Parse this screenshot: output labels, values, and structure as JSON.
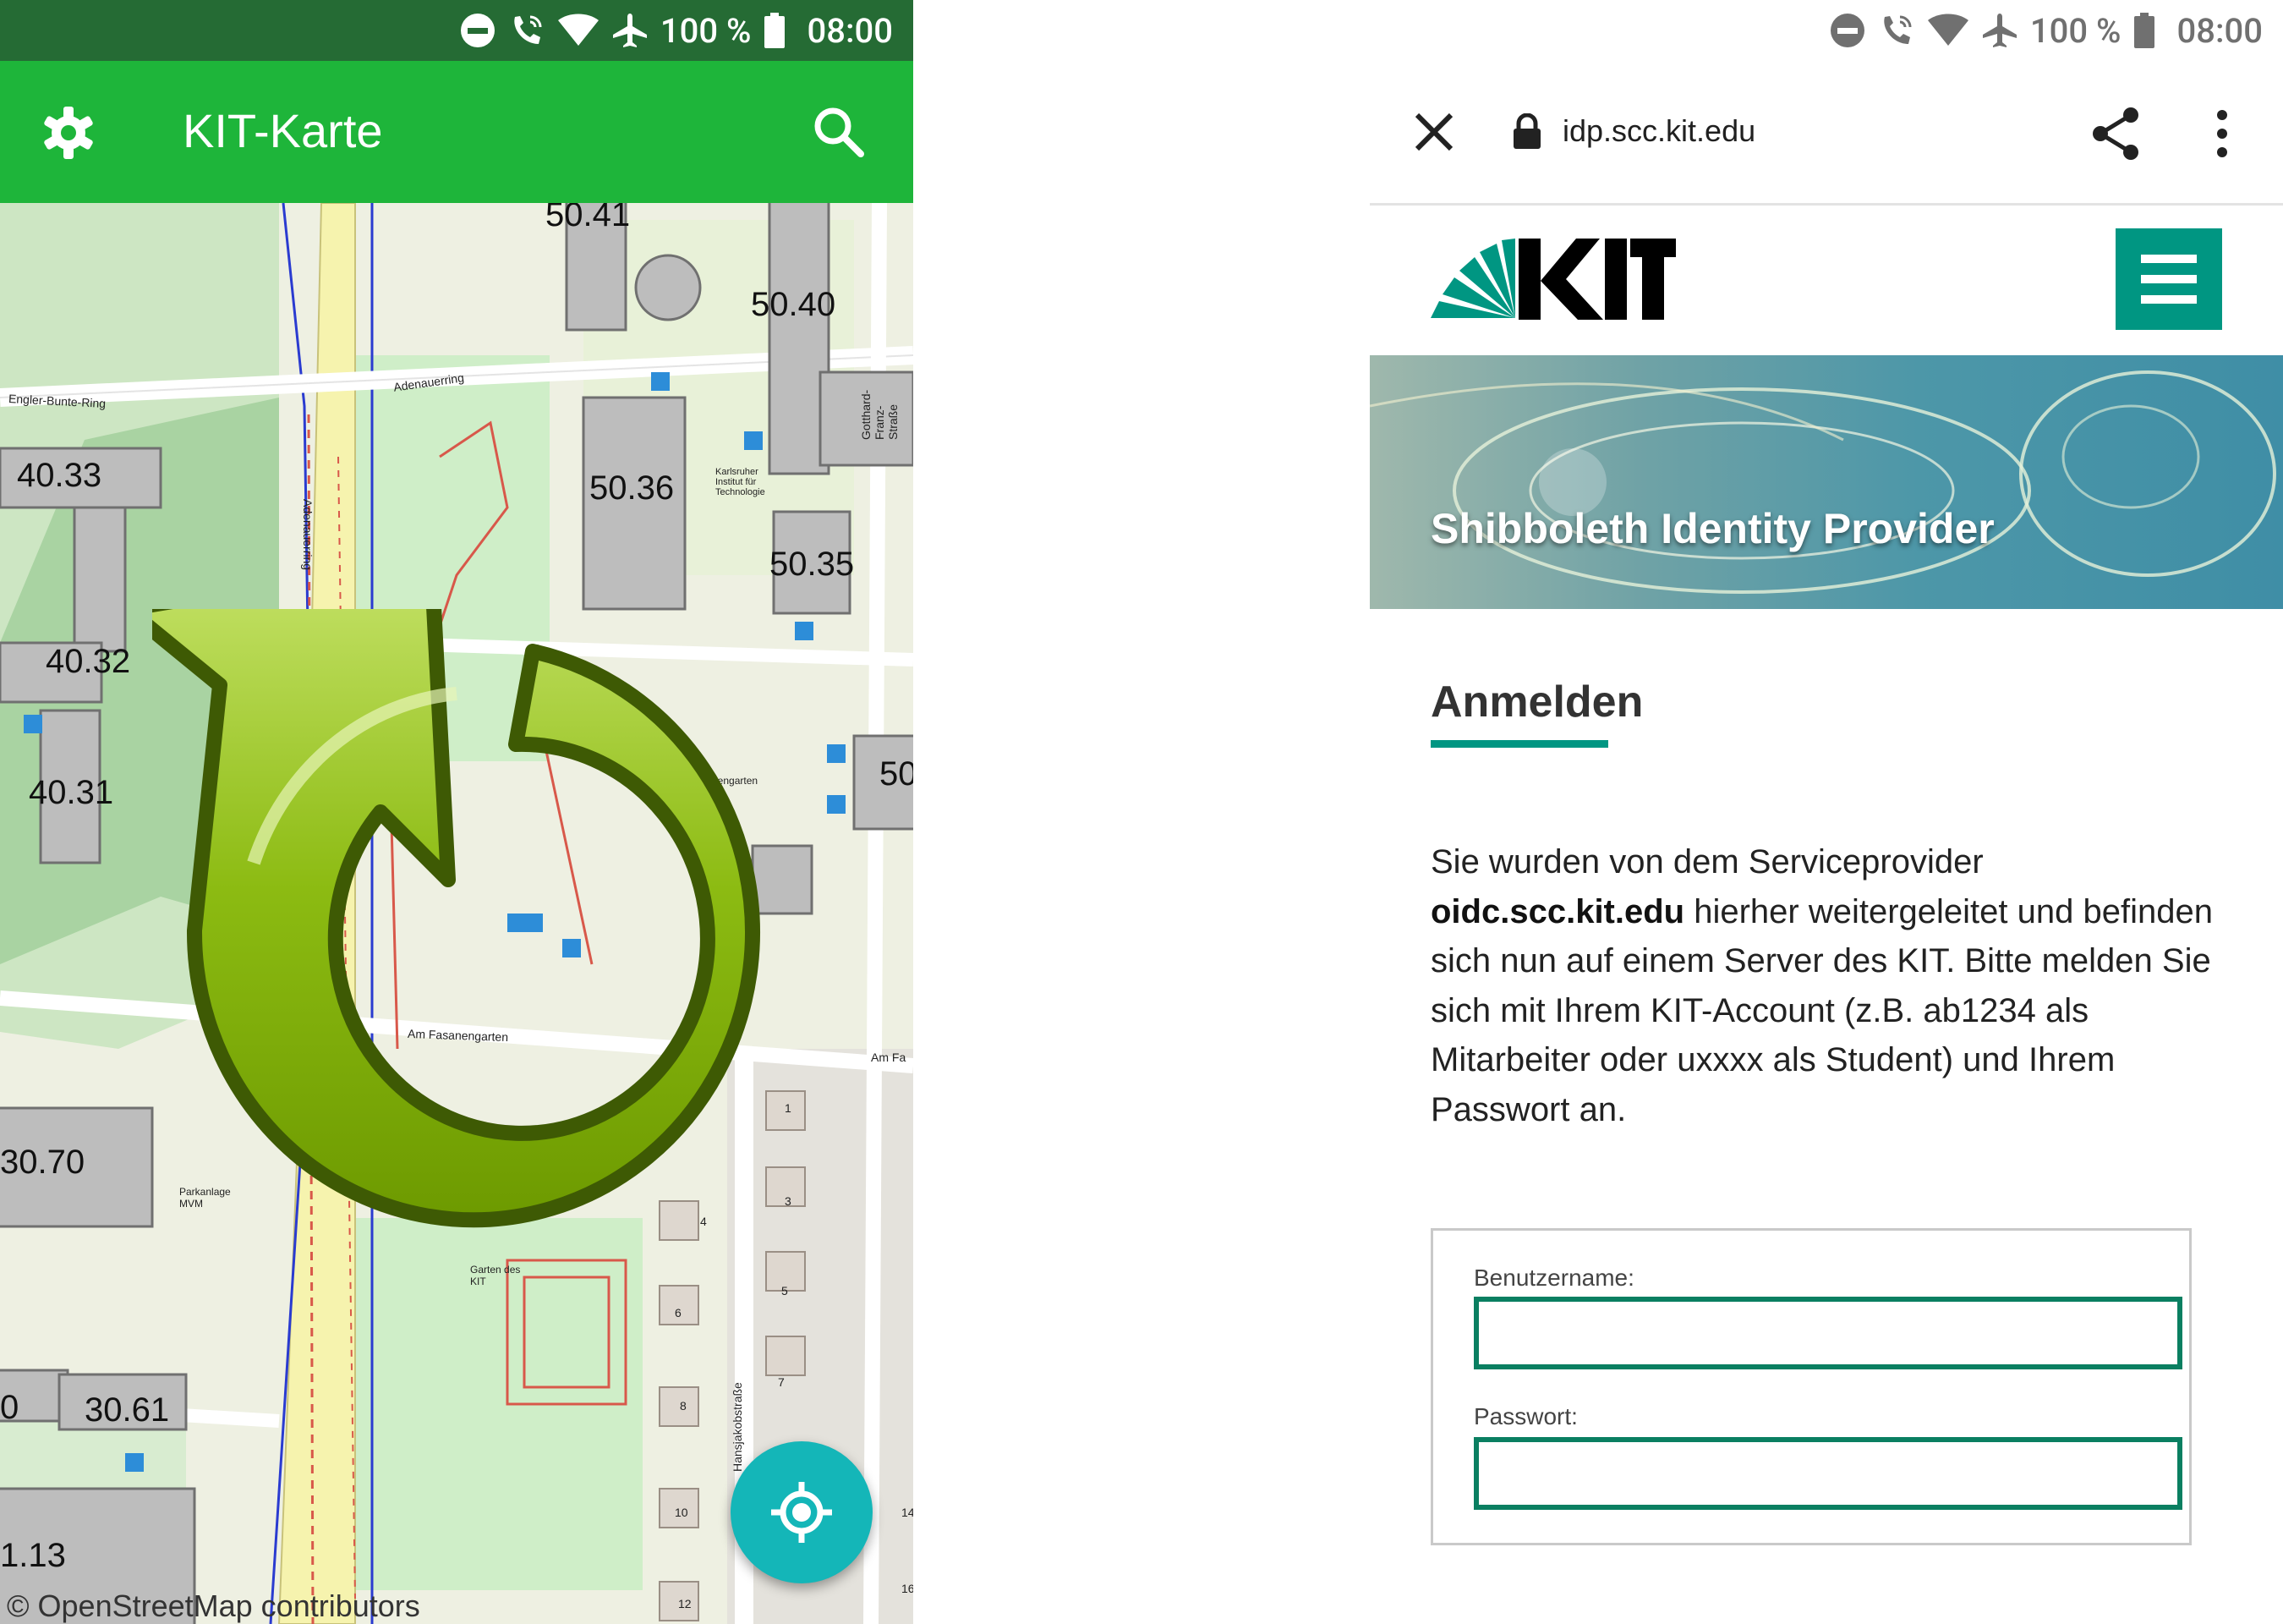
{
  "status_bar": {
    "battery": "100 %",
    "time": "08:00"
  },
  "map_app": {
    "title": "KIT-Karte",
    "credit": "© OpenStreetMap contributors",
    "building_labels": [
      "50.41",
      "50.40",
      "40.33",
      "50.36",
      "50.35",
      "40.32",
      "40.31",
      "50",
      "30.70",
      "0",
      "30.61",
      "1.13"
    ],
    "street_labels": [
      "Engler-Bunte-Ring",
      "Adenauerring",
      "Adenauerring",
      "Gotthard-Franz-Straße",
      "Am Fasanengarten",
      "Am Fa",
      "Hansjakobstraße",
      "Parkanlage MVM",
      "Garten des KIT",
      "Karlsruher Institut für Technologie",
      "nengarten"
    ],
    "house_numbers": [
      "1",
      "3",
      "4",
      "5",
      "6",
      "7",
      "8",
      "10",
      "12",
      "14",
      "16"
    ]
  },
  "browser": {
    "url": "idp.scc.kit.edu"
  },
  "page": {
    "banner_title": "Shibboleth Identity Provider",
    "heading": "Anmelden",
    "info_part1": "Sie wurden von dem Serviceprovider",
    "info_bold": "oidc.scc.kit.edu",
    "info_part2": " hierher weitergeleitet und befinden sich nun auf einem Server des KIT. Bitte melden Sie sich mit Ihrem KIT-Account (z.B. ab1234 als Mitarbeiter oder uxxxx als Student) und Ihrem Passwort an.",
    "username_label": "Benutzername:",
    "username_value": "",
    "password_label": "Passwort:",
    "password_value": ""
  },
  "colors": {
    "map_appbar": "#1eb53a",
    "map_statusbar": "#256b34",
    "kit_green": "#009682",
    "fab": "#14b6b8",
    "field_border": "#0a7f61"
  }
}
